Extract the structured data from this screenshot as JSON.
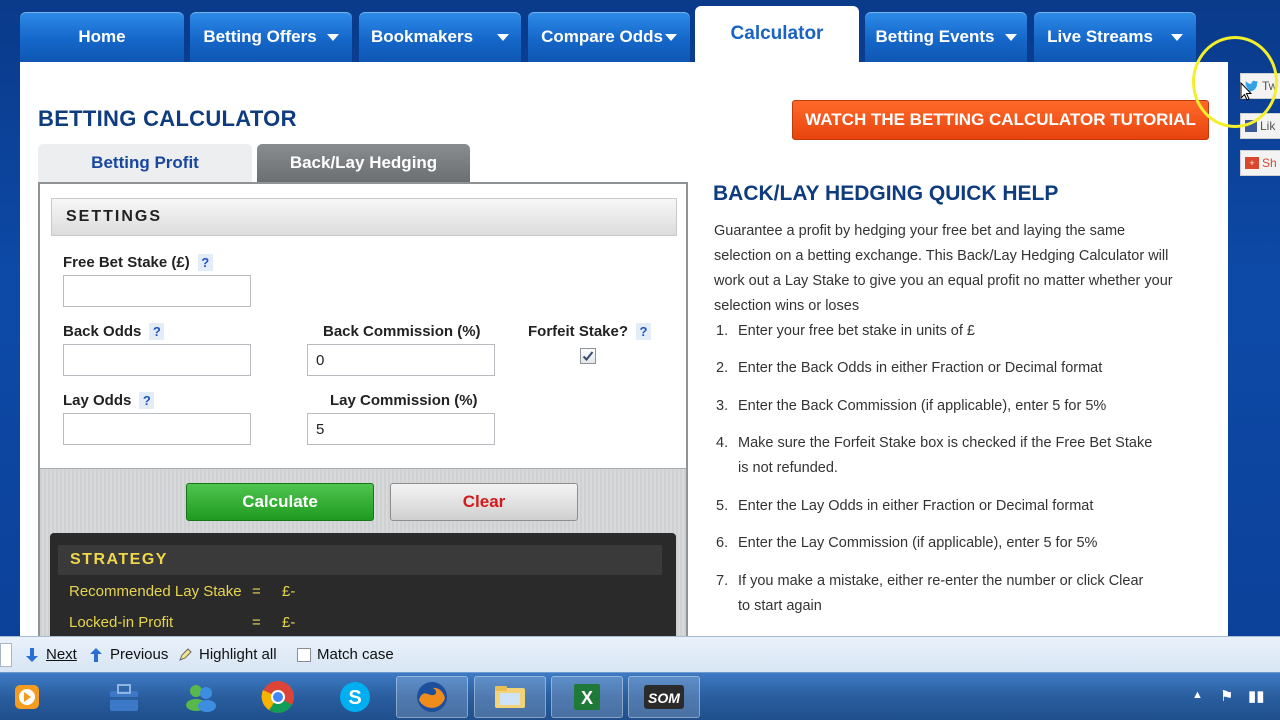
{
  "nav": {
    "tabs": [
      {
        "label": "Home",
        "caret": false
      },
      {
        "label": "Betting Offers",
        "caret": true
      },
      {
        "label": "Bookmakers",
        "caret": true
      },
      {
        "label": "Compare Odds",
        "caret": true
      },
      {
        "label": "Calculator",
        "caret": false,
        "active": true
      },
      {
        "label": "Betting Events",
        "caret": true
      },
      {
        "label": "Live Streams",
        "caret": true
      }
    ]
  },
  "page": {
    "title": "BETTING CALCULATOR",
    "tutorial_button": "WATCH THE BETTING CALCULATOR TUTORIAL"
  },
  "subtabs": {
    "profit": "Betting Profit",
    "hedging": "Back/Lay Hedging"
  },
  "settings": {
    "heading": "SETTINGS",
    "qmark": "?",
    "free_bet_stake": {
      "label": "Free Bet Stake (£)",
      "value": ""
    },
    "back_odds": {
      "label": "Back Odds",
      "value": ""
    },
    "back_commission": {
      "label": "Back Commission (%)",
      "value": "0"
    },
    "forfeit_stake": {
      "label": "Forfeit Stake?",
      "checked": true
    },
    "lay_odds": {
      "label": "Lay Odds",
      "value": ""
    },
    "lay_commission": {
      "label": "Lay Commission (%)",
      "value": "5"
    }
  },
  "actions": {
    "calculate": "Calculate",
    "clear": "Clear"
  },
  "strategy": {
    "heading": "STRATEGY",
    "rows": [
      {
        "label": "Recommended Lay Stake",
        "eq": "=",
        "value": "£-"
      },
      {
        "label": "Locked-in Profit",
        "eq": "=",
        "value": "£-"
      }
    ]
  },
  "help": {
    "title": "BACK/LAY HEDGING QUICK HELP",
    "intro": "Guarantee a profit by hedging your free bet and laying the same selection on a betting exchange. This Back/Lay Hedging Calculator will work out a Lay Stake to give you an equal profit no matter whether your selection wins or loses",
    "steps": [
      "Enter your free bet stake in units of £",
      "Enter the Back Odds in either Fraction or Decimal format",
      "Enter the Back Commission (if applicable), enter 5 for 5%",
      "Make sure the Forfeit Stake box is checked if the Free Bet Stake is not refunded.",
      "Enter the Lay Odds in either Fraction or Decimal format",
      "Enter the Lay Commission (if applicable), enter 5 for 5%",
      "If you make a mistake, either re-enter the number or click Clear to start again"
    ],
    "step_numbers": [
      "1.",
      "2.",
      "3.",
      "4.",
      "5.",
      "6.",
      "7."
    ]
  },
  "social": {
    "twitter": "Tw",
    "like": "Lik",
    "share": "Sh"
  },
  "findbar": {
    "next": "Next",
    "previous": "Previous",
    "highlight": "Highlight all",
    "match_case": "Match case"
  },
  "taskbar": {
    "apps": [
      "media-player-icon",
      "toolbox-icon",
      "messenger-icon",
      "chrome-icon",
      "skype-icon",
      "firefox-icon",
      "explorer-icon",
      "excel-icon",
      "som-icon"
    ],
    "som_label": "SOM",
    "excel_label": "X"
  },
  "colors": {
    "brand_blue": "#1a63c2",
    "title_navy": "#0f3c7e",
    "tutorial_orange": "#e8430e",
    "calc_green": "#1f9a1f",
    "clear_red": "#d21b1b",
    "strategy_yellow": "#e7d54d"
  }
}
